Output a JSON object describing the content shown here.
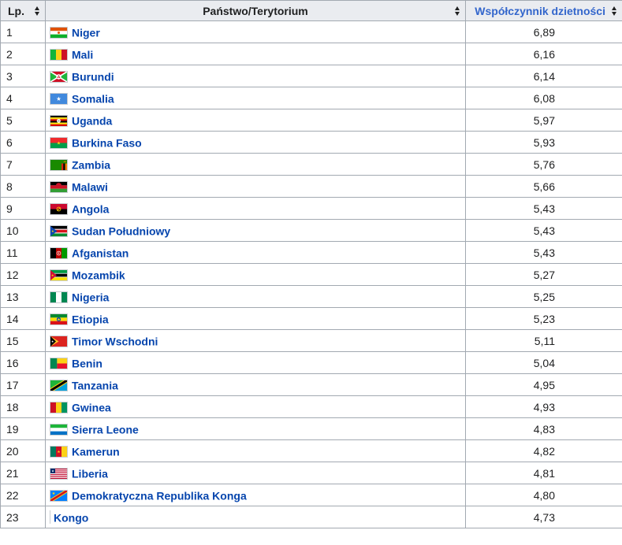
{
  "table": {
    "headers": {
      "rank": "Lp.",
      "country": "Państwo/Terytorium",
      "value": "Współczynnik dzietności"
    },
    "rows": [
      {
        "rank": "1",
        "country": "Niger",
        "value": "6,89",
        "flag": "niger-flag"
      },
      {
        "rank": "2",
        "country": "Mali",
        "value": "6,16",
        "flag": "mali-flag"
      },
      {
        "rank": "3",
        "country": "Burundi",
        "value": "6,14",
        "flag": "burundi-flag"
      },
      {
        "rank": "4",
        "country": "Somalia",
        "value": "6,08",
        "flag": "somalia-flag"
      },
      {
        "rank": "5",
        "country": "Uganda",
        "value": "5,97",
        "flag": "uganda-flag"
      },
      {
        "rank": "6",
        "country": "Burkina Faso",
        "value": "5,93",
        "flag": "burkina-faso-flag"
      },
      {
        "rank": "7",
        "country": "Zambia",
        "value": "5,76",
        "flag": "zambia-flag"
      },
      {
        "rank": "8",
        "country": "Malawi",
        "value": "5,66",
        "flag": "malawi-flag"
      },
      {
        "rank": "9",
        "country": "Angola",
        "value": "5,43",
        "flag": "angola-flag"
      },
      {
        "rank": "10",
        "country": "Sudan Południowy",
        "value": "5,43",
        "flag": "south-sudan-flag"
      },
      {
        "rank": "11",
        "country": "Afganistan",
        "value": "5,43",
        "flag": "afghanistan-flag"
      },
      {
        "rank": "12",
        "country": "Mozambik",
        "value": "5,27",
        "flag": "mozambique-flag"
      },
      {
        "rank": "13",
        "country": "Nigeria",
        "value": "5,25",
        "flag": "nigeria-flag"
      },
      {
        "rank": "14",
        "country": "Etiopia",
        "value": "5,23",
        "flag": "ethiopia-flag"
      },
      {
        "rank": "15",
        "country": "Timor Wschodni",
        "value": "5,11",
        "flag": "timor-leste-flag"
      },
      {
        "rank": "16",
        "country": "Benin",
        "value": "5,04",
        "flag": "benin-flag"
      },
      {
        "rank": "17",
        "country": "Tanzania",
        "value": "4,95",
        "flag": "tanzania-flag"
      },
      {
        "rank": "18",
        "country": "Gwinea",
        "value": "4,93",
        "flag": "guinea-flag"
      },
      {
        "rank": "19",
        "country": "Sierra Leone",
        "value": "4,83",
        "flag": "sierra-leone-flag"
      },
      {
        "rank": "20",
        "country": "Kamerun",
        "value": "4,82",
        "flag": "cameroon-flag"
      },
      {
        "rank": "21",
        "country": "Liberia",
        "value": "4,81",
        "flag": "liberia-flag"
      },
      {
        "rank": "22",
        "country": "Demokratyczna Republika Konga",
        "value": "4,80",
        "flag": "dr-congo-flag"
      },
      {
        "rank": "23",
        "country": "Kongo",
        "value": "4,73",
        "flag": ""
      }
    ]
  },
  "colors": {
    "link": "#0645ad",
    "header_bg": "#eaecf0",
    "border": "#a2a9b1"
  }
}
